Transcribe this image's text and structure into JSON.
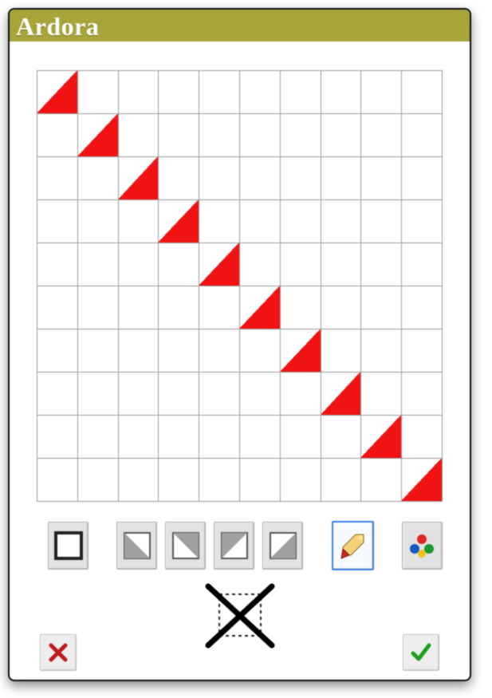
{
  "header": {
    "title": "Ardora"
  },
  "grid": {
    "rows": 10,
    "cols": 10,
    "cells": [
      [
        "tri-br",
        "",
        "",
        "",
        "",
        "",
        "",
        "",
        "",
        ""
      ],
      [
        "",
        "tri-br",
        "",
        "",
        "",
        "",
        "",
        "",
        "",
        ""
      ],
      [
        "",
        "",
        "tri-br",
        "",
        "",
        "",
        "",
        "",
        "",
        ""
      ],
      [
        "",
        "",
        "",
        "tri-br",
        "",
        "",
        "",
        "",
        "",
        ""
      ],
      [
        "",
        "",
        "",
        "",
        "tri-br",
        "",
        "",
        "",
        "",
        ""
      ],
      [
        "",
        "",
        "",
        "",
        "",
        "tri-br",
        "",
        "",
        "",
        ""
      ],
      [
        "",
        "",
        "",
        "",
        "",
        "",
        "tri-br",
        "",
        "",
        ""
      ],
      [
        "",
        "",
        "",
        "",
        "",
        "",
        "",
        "tri-br",
        "",
        ""
      ],
      [
        "",
        "",
        "",
        "",
        "",
        "",
        "",
        "",
        "tri-br",
        ""
      ],
      [
        "",
        "",
        "",
        "",
        "",
        "",
        "",
        "",
        "",
        "tri-br"
      ]
    ]
  },
  "toolbar": {
    "tools": [
      {
        "id": "tool-full-square",
        "type": "full-square",
        "selected": false
      },
      {
        "id": "tool-tri-bl",
        "type": "tri-bl",
        "selected": false
      },
      {
        "id": "tool-tri-tr",
        "type": "tri-tr",
        "selected": false
      },
      {
        "id": "tool-tri-tl",
        "type": "tri-tl",
        "selected": false
      },
      {
        "id": "tool-tri-br",
        "type": "tri-br",
        "selected": false
      },
      {
        "id": "tool-brush",
        "type": "brush",
        "selected": true
      },
      {
        "id": "tool-color",
        "type": "color-picker",
        "selected": false
      }
    ]
  },
  "actions": {
    "delete": "delete-pattern",
    "cancel": "cancel",
    "confirm": "confirm"
  },
  "colors": {
    "accent": "#a7a43a",
    "fill": "#f11313",
    "gridline": "#9a9a9a"
  }
}
